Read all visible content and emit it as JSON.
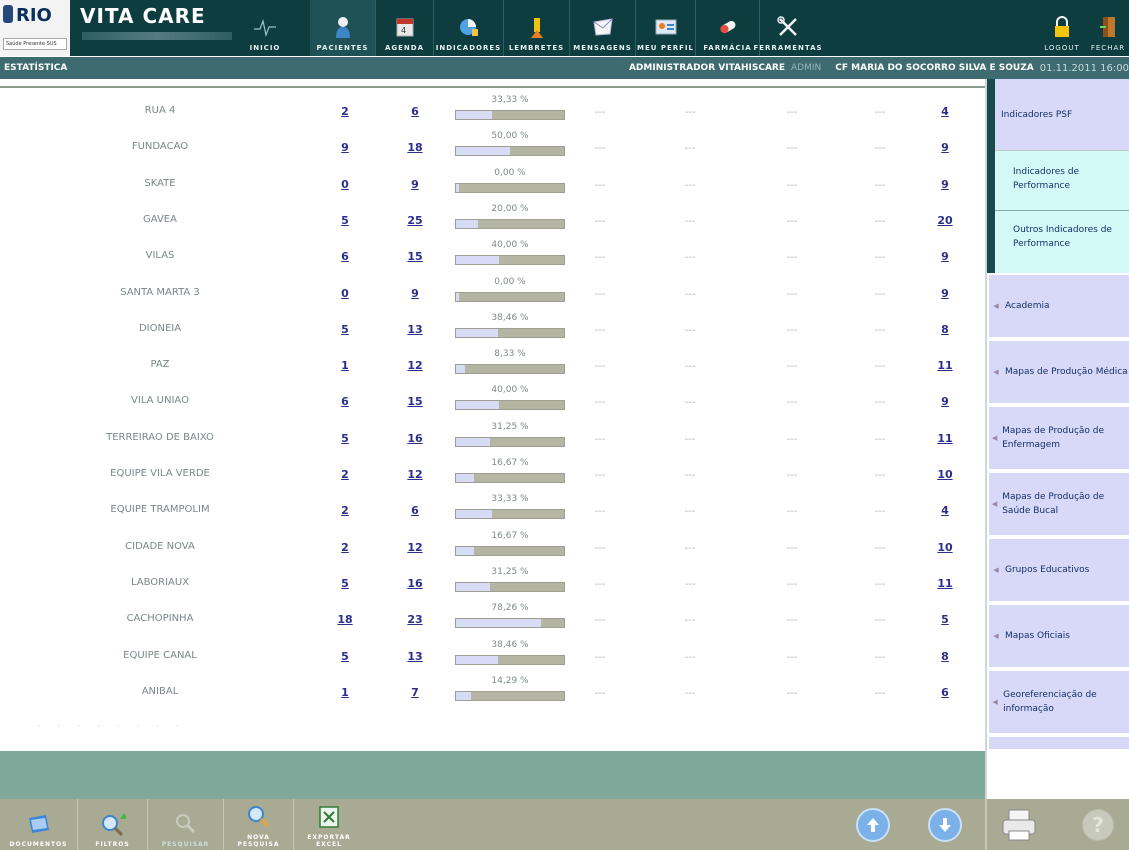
{
  "header": {
    "logo_rio": "RIO",
    "logo_rio_sub": "Saúde Presente SUS",
    "logo_vitacare": "VITA CARE",
    "nav": [
      {
        "label": "INICIO",
        "icon": "heartbeat-icon"
      },
      {
        "label": "PACIENTES",
        "icon": "patient-icon"
      },
      {
        "label": "AGENDA",
        "icon": "calendar-icon"
      },
      {
        "label": "INDICADORES",
        "icon": "indicators-icon"
      },
      {
        "label": "LEMBRETES",
        "icon": "reminder-icon"
      },
      {
        "label": "MENSAGENS",
        "icon": "message-icon"
      },
      {
        "label": "MEU PERFIL",
        "icon": "profile-icon"
      },
      {
        "label": "FARMÁCIA",
        "icon": "pill-icon"
      },
      {
        "label": "FERRAMENTAS",
        "icon": "tools-icon"
      }
    ],
    "logout": "LOGOUT",
    "close": "FECHAR"
  },
  "infobar": {
    "section": "ESTATÍSTICA",
    "user": "ADMINISTRADOR VITAHISCARE",
    "role": "ADMIN",
    "unit": "CF MARIA DO SOCORRO SILVA E SOUZA",
    "datetime": "01.11.2011 16:00"
  },
  "table": {
    "dash": "---",
    "rows": [
      {
        "name": "RUA 4",
        "n1": "2",
        "n2": "6",
        "pct": "33,33 %",
        "pct_value": 33.33,
        "last": "4"
      },
      {
        "name": "FUNDACAO",
        "n1": "9",
        "n2": "18",
        "pct": "50,00 %",
        "pct_value": 50.0,
        "last": "9"
      },
      {
        "name": "SKATE",
        "n1": "0",
        "n2": "9",
        "pct": "0,00 %",
        "pct_value": 0,
        "last": "9"
      },
      {
        "name": "GAVEA",
        "n1": "5",
        "n2": "25",
        "pct": "20,00 %",
        "pct_value": 20.0,
        "last": "20"
      },
      {
        "name": "VILAS",
        "n1": "6",
        "n2": "15",
        "pct": "40,00 %",
        "pct_value": 40.0,
        "last": "9"
      },
      {
        "name": "SANTA MARTA 3",
        "n1": "0",
        "n2": "9",
        "pct": "0,00 %",
        "pct_value": 0,
        "last": "9"
      },
      {
        "name": "DIONEIA",
        "n1": "5",
        "n2": "13",
        "pct": "38,46 %",
        "pct_value": 38.46,
        "last": "8"
      },
      {
        "name": "PAZ",
        "n1": "1",
        "n2": "12",
        "pct": "8,33 %",
        "pct_value": 8.33,
        "last": "11"
      },
      {
        "name": "VILA UNIAO",
        "n1": "6",
        "n2": "15",
        "pct": "40,00 %",
        "pct_value": 40.0,
        "last": "9"
      },
      {
        "name": "TERREIRAO DE BAIXO",
        "n1": "5",
        "n2": "16",
        "pct": "31,25 %",
        "pct_value": 31.25,
        "last": "11"
      },
      {
        "name": "EQUIPE VILA VERDE",
        "n1": "2",
        "n2": "12",
        "pct": "16,67 %",
        "pct_value": 16.67,
        "last": "10"
      },
      {
        "name": "EQUIPE TRAMPOLIM",
        "n1": "2",
        "n2": "6",
        "pct": "33,33 %",
        "pct_value": 33.33,
        "last": "4"
      },
      {
        "name": "CIDADE NOVA",
        "n1": "2",
        "n2": "12",
        "pct": "16,67 %",
        "pct_value": 16.67,
        "last": "10"
      },
      {
        "name": "LABORIAUX",
        "n1": "5",
        "n2": "16",
        "pct": "31,25 %",
        "pct_value": 31.25,
        "last": "11"
      },
      {
        "name": "CACHOPINHA",
        "n1": "18",
        "n2": "23",
        "pct": "78,26 %",
        "pct_value": 78.26,
        "last": "5"
      },
      {
        "name": "EQUIPE CANAL",
        "n1": "5",
        "n2": "13",
        "pct": "38,46 %",
        "pct_value": 38.46,
        "last": "8"
      },
      {
        "name": "ANIBAL",
        "n1": "1",
        "n2": "7",
        "pct": "14,29 %",
        "pct_value": 14.29,
        "last": "6"
      }
    ]
  },
  "sidebar": {
    "items": [
      {
        "label": "Indicadores PSF"
      },
      {
        "label": "Academia"
      },
      {
        "label": "Mapas de Produção Médica"
      },
      {
        "label": "Mapas de Produção de Enfermagem"
      },
      {
        "label": "Mapas de Produção de Saúde Bucal"
      },
      {
        "label": "Grupos Educativos"
      },
      {
        "label": "Mapas Oficiais"
      },
      {
        "label": "Georeferenciação de informação"
      }
    ],
    "subitems": [
      {
        "label": "Indicadores de Performance"
      },
      {
        "label": "Outros Indicadores de Performance"
      }
    ]
  },
  "toolbar": {
    "documents": "DOCUMENTOS",
    "filters": "FILTROS",
    "search": "PESQUISAR",
    "new_search_1": "NOVA",
    "new_search_2": "PESQUISA",
    "export_1": "EXPORTAR",
    "export_2": "EXCEL"
  },
  "colors": {
    "header_bg": "#0e3d40",
    "link": "#2a2f8c",
    "bar_bg": "#b5b5a4",
    "bar_fill": "#d7dbf5",
    "sidebar_item": "#d8d8f8",
    "sidebar_sub": "#d4faf7"
  }
}
